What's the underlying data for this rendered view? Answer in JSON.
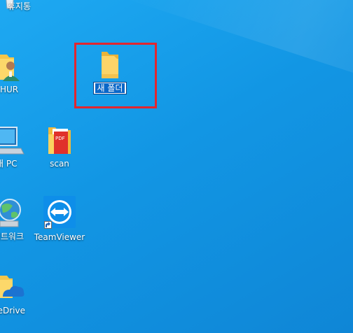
{
  "desktop": {
    "icons": {
      "recycle_bin": {
        "label": "휴지통",
        "icon": "recycle-bin-icon"
      },
      "user_folder": {
        "label": "HUR",
        "icon": "user-folder-icon"
      },
      "this_pc": {
        "label": "내 PC",
        "icon": "this-pc-icon"
      },
      "scan": {
        "label": "scan",
        "icon": "pdf-folder-icon"
      },
      "network": {
        "label": "네트워크",
        "icon": "network-icon"
      },
      "teamviewer": {
        "label": "TeamViewer",
        "icon": "teamviewer-icon"
      },
      "onedrive": {
        "label": "OneDrive",
        "icon": "onedrive-icon"
      },
      "new_folder": {
        "label": "새 폴더",
        "icon": "folder-icon",
        "state": "renaming"
      }
    },
    "colors": {
      "wallpaper": "#1296e4",
      "highlight_box": "#e2262f",
      "rename_selection": "#0a67c8"
    }
  }
}
